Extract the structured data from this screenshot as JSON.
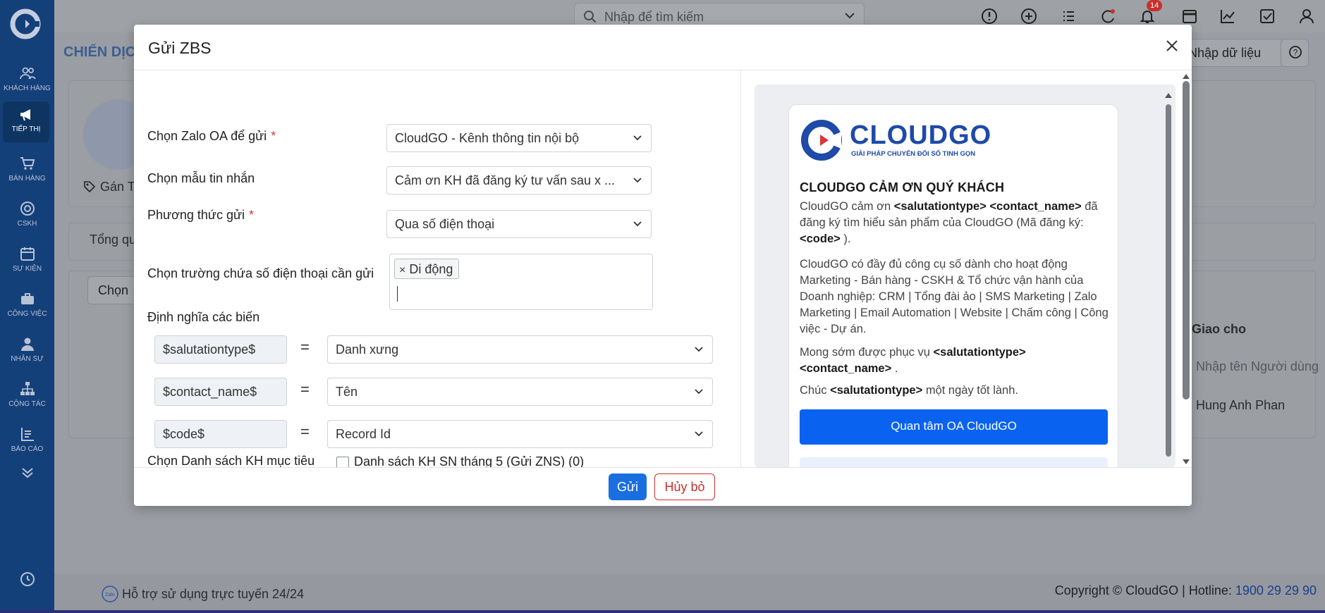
{
  "app": {
    "search_placeholder": "Nhập để tìm kiếm",
    "notification_count": "14",
    "sidebar": [
      {
        "key": "customers",
        "label": "KHÁCH HÀNG",
        "icon": "customers-icon"
      },
      {
        "key": "marketing",
        "label": "TIẾP THỊ",
        "icon": "megaphone-icon"
      },
      {
        "key": "sales",
        "label": "BÁN HÀNG",
        "icon": "cart-icon"
      },
      {
        "key": "support",
        "label": "CSKH",
        "icon": "lifebuoy-icon"
      },
      {
        "key": "events",
        "label": "SỰ KIỆN",
        "icon": "calendar-icon"
      },
      {
        "key": "work",
        "label": "CÔNG VIỆC",
        "icon": "briefcase-icon"
      },
      {
        "key": "staff",
        "label": "NHÂN SỰ",
        "icon": "person-icon"
      },
      {
        "key": "collab",
        "label": "CỘNG TÁC",
        "icon": "org-chart-icon"
      },
      {
        "key": "reports",
        "label": "BÁO CÁO",
        "icon": "report-icon"
      }
    ]
  },
  "background": {
    "page_title": "CHIẾN DỊCH",
    "import_label": "Nhập dữ liệu",
    "tag_label": "Gán T",
    "tab_label": "Tổng qu",
    "select_label": "Chọn",
    "col_assignee": "Giao cho",
    "filter_placeholder": "Nhập tên Người dùng",
    "row_assignee": "Hung Anh Phan"
  },
  "footer": {
    "help_text": "Hỗ trợ sử dụng trực tuyến 24/24",
    "copyright": "Copyright © CloudGO",
    "hotline_label": "Hotline:",
    "hotline_number": "1900 29 29 90"
  },
  "modal": {
    "title": "Gửi ZBS",
    "fields": {
      "oa_label": "Chọn Zalo OA để gửi",
      "oa_value": "CloudGO - Kênh thông tin nội bộ",
      "template_label": "Chọn mẫu tin nhắn",
      "template_value": "Cảm ơn KH đã đăng ký tư vấn sau x ...",
      "method_label": "Phương thức gửi",
      "method_value": "Qua số điện thoại",
      "phone_field_label": "Chọn trường chứa số điện thoại cần gửi",
      "phone_tag": "Di động",
      "variables_label": "Định nghĩa các biến",
      "variables": [
        {
          "name": "$salutationtype$",
          "value": "Danh xưng"
        },
        {
          "name": "$contact_name$",
          "value": "Tên"
        },
        {
          "name": "$code$",
          "value": "Record Id"
        }
      ],
      "target_list_label": "Chọn Danh sách KH mục tiêu",
      "target_list_option": "Danh sách KH SN tháng 5 (Gửi ZNS) (0)"
    },
    "buttons": {
      "send": "Gửi",
      "cancel": "Hủy bỏ"
    },
    "preview": {
      "brand": "CLOUDGO",
      "brand_tagline": "GIẢI PHÁP CHUYỂN ĐỔI SỐ TINH GỌN",
      "heading": "CLOUDGO CẢM ƠN QUÝ KHÁCH",
      "cta_button": "Quan tâm OA CloudGO"
    }
  }
}
